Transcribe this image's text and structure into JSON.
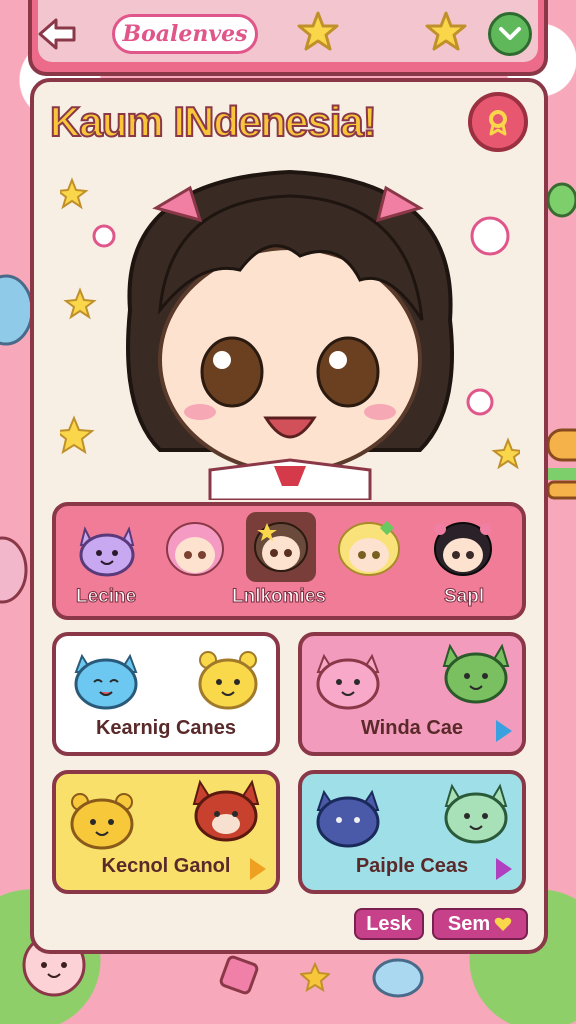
{
  "header": {
    "app_title": "Boalenves",
    "icons": [
      "back-arrow-icon",
      "star-icon",
      "star-icon",
      "checkmark-icon"
    ]
  },
  "main": {
    "headline": "Kaum INdenesia!",
    "profile_icon": "ribbon-icon"
  },
  "character_strip": {
    "items": [
      {
        "name": "purple-cat",
        "label": "Lecine"
      },
      {
        "name": "pink-hair-girl",
        "label": ""
      },
      {
        "name": "brown-hair-girl",
        "label": "Lnlkomies",
        "selected": true
      },
      {
        "name": "blonde-girl",
        "label": ""
      },
      {
        "name": "dark-hair-girl",
        "label": "Sapl"
      }
    ]
  },
  "cards": [
    {
      "label": "Kearnig Canes",
      "color": "#ffffff",
      "has_arrow": false
    },
    {
      "label": "Winda Cae",
      "color": "#f39bbc",
      "has_arrow": true,
      "arrow_color": "#3aa0e0"
    },
    {
      "label": "Kecnol Ganol",
      "color": "#f9e06a",
      "has_arrow": true,
      "arrow_color": "#f0a020"
    },
    {
      "label": "Paiple Ceas",
      "color": "#9fe0e8",
      "has_arrow": true,
      "arrow_color": "#b040c0"
    }
  ],
  "footer": {
    "left_button": "Lesk",
    "right_button": "Sem",
    "right_icon": "heart-icon"
  },
  "colors": {
    "background": "#f7a9bb",
    "panel": "#f7efe4",
    "border": "#8a3848",
    "headline": "#f7c63a",
    "accent": "#ec6a8a"
  }
}
